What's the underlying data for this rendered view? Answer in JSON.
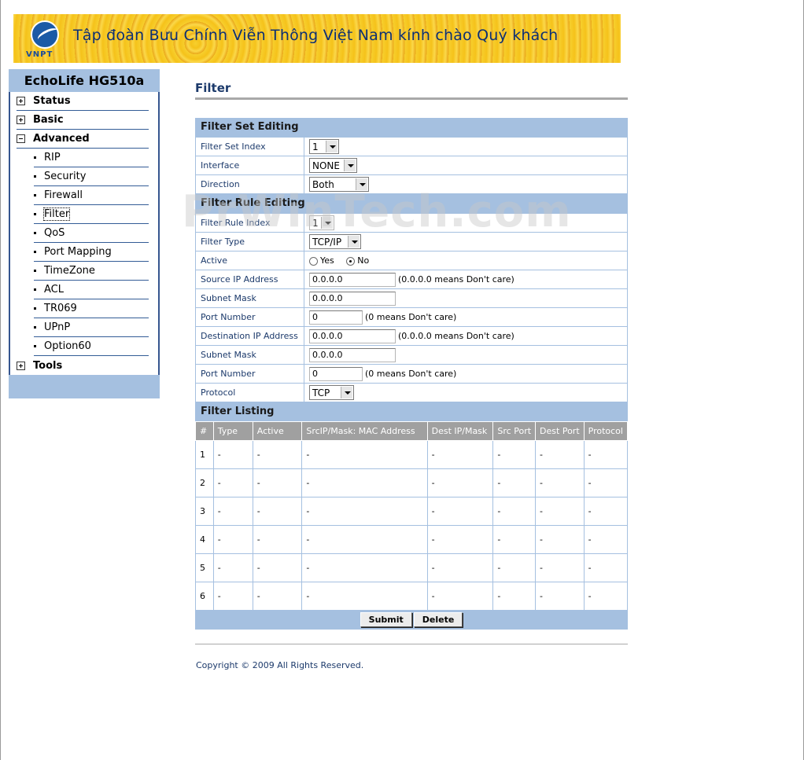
{
  "banner": {
    "logo_text": "VNPT",
    "greeting": "Tập đoàn Bưu Chính Viễn Thông Việt Nam kính chào Quý khách"
  },
  "sidebar": {
    "device_name": "EchoLife HG510a",
    "items": [
      {
        "label": "Status",
        "expanded": false
      },
      {
        "label": "Basic",
        "expanded": false
      },
      {
        "label": "Advanced",
        "expanded": true
      },
      {
        "label": "Tools",
        "expanded": false
      }
    ],
    "advanced_sub": [
      "RIP",
      "Security",
      "Firewall",
      "Filter",
      "QoS",
      "Port Mapping",
      "TimeZone",
      "ACL",
      "TR069",
      "UPnP",
      "Option60"
    ],
    "active_sub": "Filter"
  },
  "main": {
    "title": "Filter",
    "filter_set": {
      "section_title": "Filter Set Editing",
      "index_label": "Filter Set Index",
      "index_value": "1",
      "interface_label": "Interface",
      "interface_value": "NONE",
      "direction_label": "Direction",
      "direction_value": "Both"
    },
    "filter_rule": {
      "section_title": "Filter Rule Editing",
      "index_label": "Filter Rule Index",
      "index_value": "1",
      "type_label": "Filter Type",
      "type_value": "TCP/IP",
      "active_label": "Active",
      "active_yes": "Yes",
      "active_no": "No",
      "active_selected": "No",
      "src_ip_label": "Source IP Address",
      "src_ip_value": "0.0.0.0",
      "src_ip_hint": "(0.0.0.0 means Don't care)",
      "src_mask_label": "Subnet Mask",
      "src_mask_value": "0.0.0.0",
      "src_port_label": "Port Number",
      "src_port_value": "0",
      "src_port_hint": "(0 means Don't care)",
      "dst_ip_label": "Destination IP Address",
      "dst_ip_value": "0.0.0.0",
      "dst_ip_hint": "(0.0.0.0 means Don't care)",
      "dst_mask_label": "Subnet Mask",
      "dst_mask_value": "0.0.0.0",
      "dst_port_label": "Port Number",
      "dst_port_value": "0",
      "dst_port_hint": "(0 means Don't care)",
      "protocol_label": "Protocol",
      "protocol_value": "TCP"
    },
    "listing": {
      "section_title": "Filter Listing",
      "columns": [
        "#",
        "Type",
        "Active",
        "SrcIP/Mask: MAC Address",
        "Dest IP/Mask",
        "Src Port",
        "Dest Port",
        "Protocol"
      ],
      "rows": [
        [
          "1",
          "-",
          "-",
          "-",
          "-",
          "-",
          "-",
          "-"
        ],
        [
          "2",
          "-",
          "-",
          "-",
          "-",
          "-",
          "-",
          "-"
        ],
        [
          "3",
          "-",
          "-",
          "-",
          "-",
          "-",
          "-",
          "-"
        ],
        [
          "4",
          "-",
          "-",
          "-",
          "-",
          "-",
          "-",
          "-"
        ],
        [
          "5",
          "-",
          "-",
          "-",
          "-",
          "-",
          "-",
          "-"
        ],
        [
          "6",
          "-",
          "-",
          "-",
          "-",
          "-",
          "-",
          "-"
        ]
      ]
    },
    "buttons": {
      "submit": "Submit",
      "delete": "Delete"
    },
    "copyright": "Copyright © 2009 All Rights Reserved."
  },
  "watermark": "PrWinTech.com",
  "colors": {
    "accent": "#a5c0e0",
    "title": "#1c3a6b",
    "sidebar_border": "#36568f"
  }
}
